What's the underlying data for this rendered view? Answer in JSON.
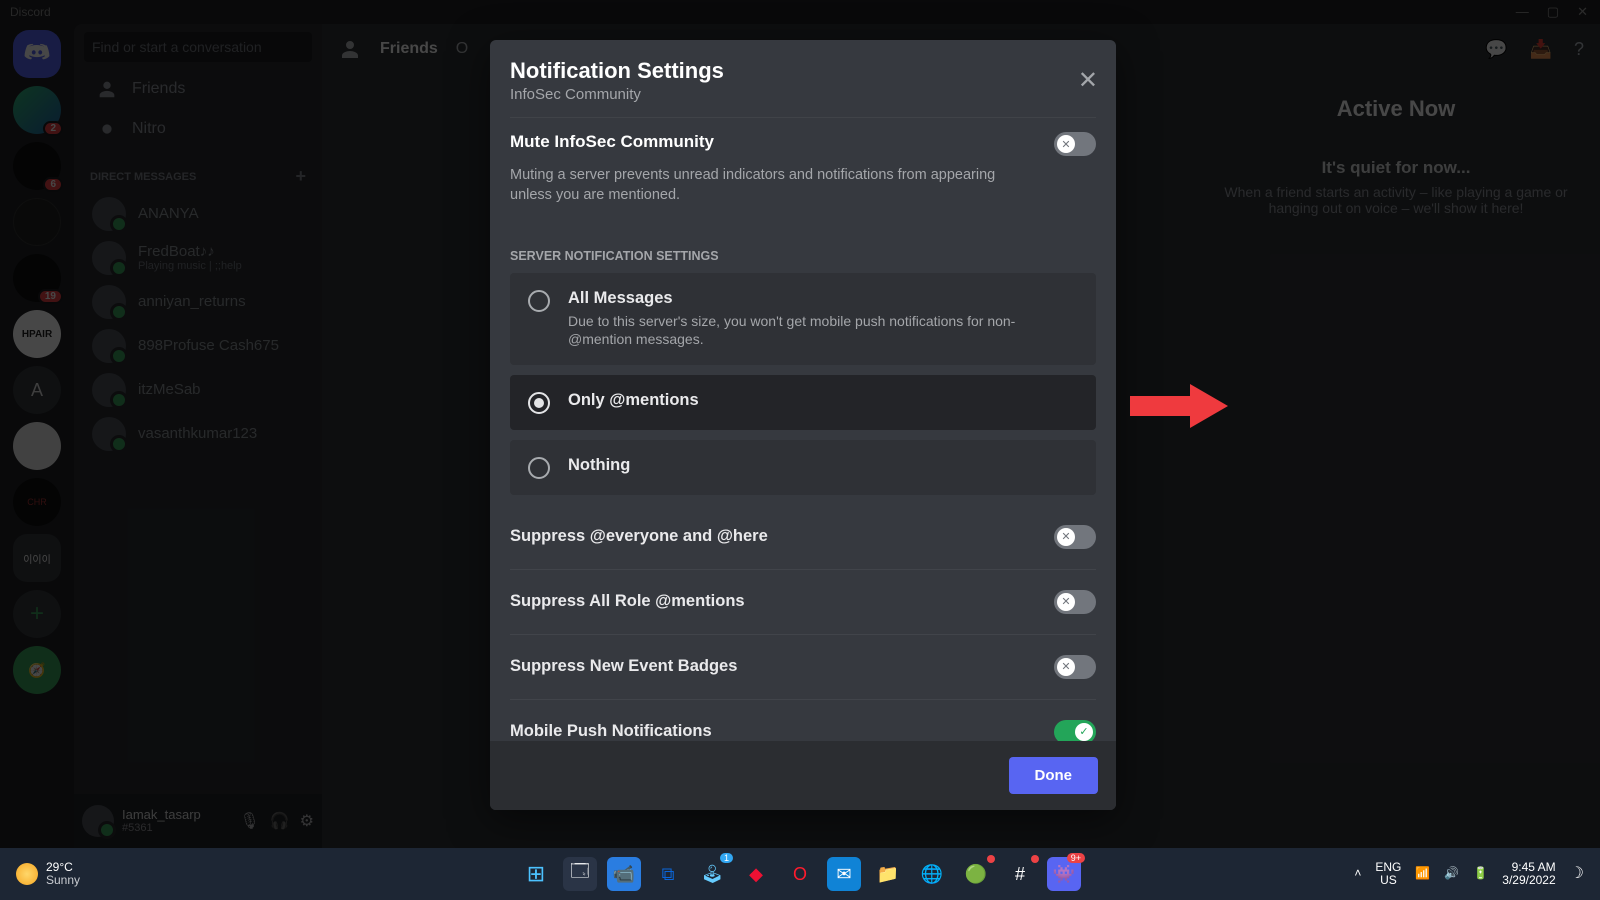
{
  "app_name": "Discord",
  "window_controls": {
    "min": "—",
    "max": "▢",
    "close": "✕"
  },
  "search": {
    "placeholder": "Find or start a conversation"
  },
  "nav": {
    "friends": "Friends",
    "nitro": "Nitro",
    "dm_section": "DIRECT MESSAGES"
  },
  "dms": [
    {
      "name": "ANANYA",
      "sub": ""
    },
    {
      "name": "FredBoat♪♪",
      "sub": "Playing music | ;;help"
    },
    {
      "name": "anniyan_returns",
      "sub": ""
    },
    {
      "name": "898Profuse Cash675",
      "sub": ""
    },
    {
      "name": "itzMeSab",
      "sub": ""
    },
    {
      "name": "vasanthkumar123",
      "sub": ""
    }
  ],
  "user": {
    "name": "Iamak_tasarp",
    "tag": "#5361"
  },
  "topbar": {
    "friends": "Friends",
    "online": "O"
  },
  "active_now": {
    "title": "Active Now",
    "subtitle": "It's quiet for now...",
    "body": "When a friend starts an activity – like playing a game or hanging out on voice – we'll show it here!"
  },
  "modal": {
    "title": "Notification Settings",
    "server": "InfoSec Community",
    "mute": {
      "prefix": "Mute ",
      "target": "InfoSec Community",
      "desc": "Muting a server prevents unread indicators and notifications from appearing unless you are mentioned.",
      "on": false
    },
    "section_cap": "SERVER NOTIFICATION SETTINGS",
    "radios": {
      "all": {
        "label": "All Messages",
        "desc": "Due to this server's size, you won't get mobile push notifications for non-@mention messages."
      },
      "mentions": {
        "label": "Only @mentions"
      },
      "nothing": {
        "label": "Nothing"
      },
      "selected": "mentions"
    },
    "toggles": [
      {
        "label": "Suppress @everyone and @here",
        "on": false
      },
      {
        "label": "Suppress All Role @mentions",
        "on": false
      },
      {
        "label": "Suppress New Event Badges",
        "on": false
      },
      {
        "label": "Mobile Push Notifications",
        "on": true
      }
    ],
    "done": "Done"
  },
  "servers": {
    "badges": {
      "s1": "2",
      "s2": "6",
      "s3": "19"
    },
    "labels": {
      "hpair": "HPAIR",
      "a": "A"
    }
  },
  "taskbar": {
    "weather": {
      "temp": "29°C",
      "desc": "Sunny"
    },
    "lang1": "ENG",
    "lang2": "US",
    "time": "9:45 AM",
    "date": "3/29/2022"
  }
}
